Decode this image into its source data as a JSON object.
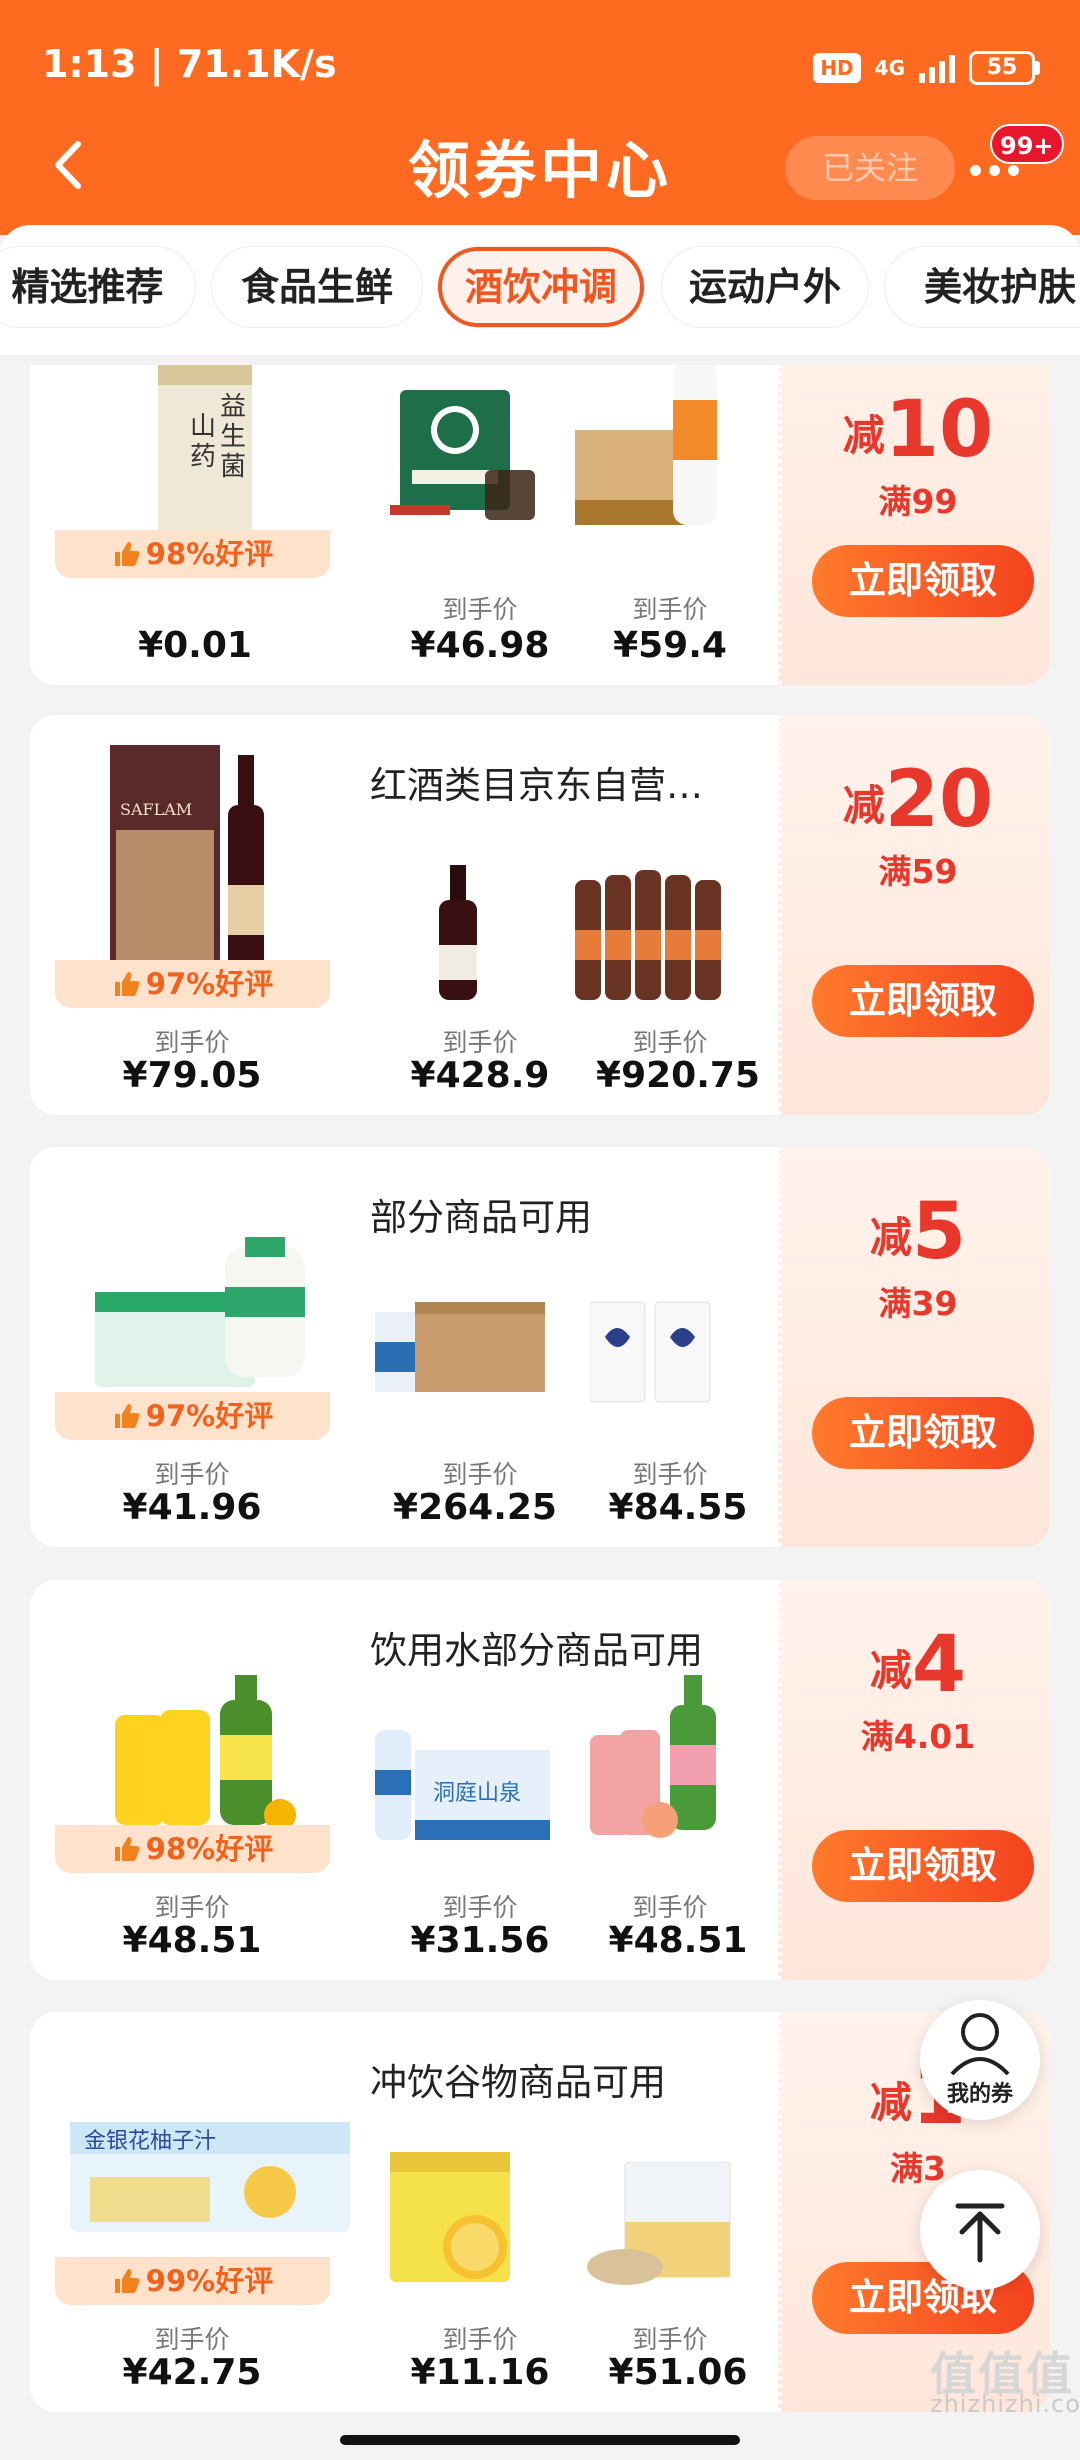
{
  "status_bar": {
    "time": "1:13 | 71.1K/s",
    "hd": "HD",
    "network": "4G",
    "battery": "55"
  },
  "header": {
    "title": "领券中心",
    "follow_label": "已关注",
    "badge": "99+"
  },
  "tabs": [
    {
      "label": "精选推荐",
      "active": false
    },
    {
      "label": "食品生鲜",
      "active": false
    },
    {
      "label": "酒饮冲调",
      "active": true
    },
    {
      "label": "运动户外",
      "active": false
    },
    {
      "label": "美妆护肤",
      "active": false
    }
  ],
  "price_label": "到手价",
  "claim_label": "立即领取",
  "cards": [
    {
      "title": "",
      "rating": "98%好评",
      "prices": [
        "¥0.01",
        "¥46.98",
        "¥59.4"
      ],
      "show_first_label": false,
      "coupon": {
        "jian": "减",
        "amount": "10",
        "cond": "满99"
      }
    },
    {
      "title": "红酒类目京东自营…",
      "rating": "97%好评",
      "prices": [
        "¥79.05",
        "¥428.9",
        "¥920.75"
      ],
      "show_first_label": true,
      "coupon": {
        "jian": "减",
        "amount": "20",
        "cond": "满59"
      }
    },
    {
      "title": "部分商品可用",
      "rating": "97%好评",
      "prices": [
        "¥41.96",
        "¥264.25",
        "¥84.55"
      ],
      "show_first_label": true,
      "coupon": {
        "jian": "减",
        "amount": "5",
        "cond": "满39"
      }
    },
    {
      "title": "饮用水部分商品可用",
      "rating": "98%好评",
      "prices": [
        "¥48.51",
        "¥31.56",
        "¥48.51"
      ],
      "show_first_label": true,
      "coupon": {
        "jian": "减",
        "amount": "4",
        "cond": "满4.01"
      }
    },
    {
      "title": "冲饮谷物商品可用",
      "rating": "99%好评",
      "prices": [
        "¥42.75",
        "¥11.16",
        "¥51.06"
      ],
      "show_first_label": true,
      "coupon": {
        "jian": "减",
        "amount": "1",
        "cond": "满3"
      }
    }
  ],
  "floating": {
    "my_coupons": "我的券"
  },
  "watermark": {
    "logo": "值值值",
    "url": "zhizhizhi.com"
  }
}
